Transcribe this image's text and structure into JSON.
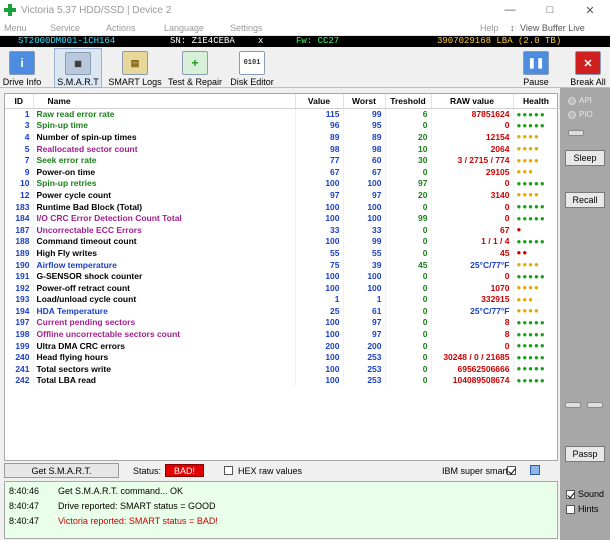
{
  "window": {
    "title": "Victoria 5.37 HDD/SSD | Device 2",
    "buttons": {
      "minimize": "—",
      "maximize": "□",
      "close": "✕"
    }
  },
  "menu": [
    "Menu",
    "Service",
    "Actions",
    "Language",
    "Settings",
    "Help"
  ],
  "menu_right": {
    "help_arrow": "↕",
    "view_buffer": "View Buffer Live"
  },
  "infobar": {
    "model": "ST2000DM001-1CH164",
    "sn": "SN: Z1E4CEBA",
    "close": "x",
    "fw": "Fw: CC27",
    "lba": "3907029168 LBA (2.0 TB)"
  },
  "toolbar": [
    {
      "label": "Drive Info",
      "icon": "info-icon"
    },
    {
      "label": "S.M.A.R.T",
      "icon": "smart-icon"
    },
    {
      "label": "SMART Logs",
      "icon": "logs-icon"
    },
    {
      "label": "Test & Repair",
      "icon": "repair-icon"
    },
    {
      "label": "Disk Editor",
      "icon": "editor-icon"
    }
  ],
  "toolbar_right": {
    "pause": "Pause",
    "break": "Break All"
  },
  "table": {
    "headers": [
      "ID",
      "Name",
      "Value",
      "Worst",
      "Treshold",
      "RAW value",
      "Health"
    ],
    "rows": [
      {
        "id": "1",
        "name": "Raw read error rate",
        "value": "115",
        "worst": "99",
        "tres": "6",
        "raw": "87851624",
        "health": "●●●●●",
        "nc": "#1a7f1a",
        "rc": "#cc0000",
        "hc": "#1a9f1a"
      },
      {
        "id": "3",
        "name": "Spin-up time",
        "value": "96",
        "worst": "95",
        "tres": "0",
        "raw": "0",
        "health": "●●●●●",
        "nc": "#1a7f1a",
        "rc": "#cc0000",
        "hc": "#1a9f1a"
      },
      {
        "id": "4",
        "name": "Number of spin-up times",
        "value": "89",
        "worst": "89",
        "tres": "20",
        "raw": "12154",
        "health": "●●●●",
        "nc": "#000000",
        "rc": "#cc0000",
        "hc": "#e8a800"
      },
      {
        "id": "5",
        "name": "Reallocated sector count",
        "value": "98",
        "worst": "98",
        "tres": "10",
        "raw": "2064",
        "health": "●●●●",
        "nc": "#a0208f",
        "rc": "#cc0000",
        "hc": "#e8a800"
      },
      {
        "id": "7",
        "name": "Seek error rate",
        "value": "77",
        "worst": "60",
        "tres": "30",
        "raw": "3 / 2715 / 774",
        "health": "●●●●",
        "nc": "#1a7f1a",
        "rc": "#cc0000",
        "hc": "#e8a800"
      },
      {
        "id": "9",
        "name": "Power-on time",
        "value": "67",
        "worst": "67",
        "tres": "0",
        "raw": "29105",
        "health": "●●●",
        "nc": "#000000",
        "rc": "#cc0000",
        "hc": "#e8a800"
      },
      {
        "id": "10",
        "name": "Spin-up retries",
        "value": "100",
        "worst": "100",
        "tres": "97",
        "raw": "0",
        "health": "●●●●●",
        "nc": "#1a7f1a",
        "rc": "#cc0000",
        "hc": "#1a9f1a"
      },
      {
        "id": "12",
        "name": "Power cycle count",
        "value": "97",
        "worst": "97",
        "tres": "20",
        "raw": "3140",
        "health": "●●●●",
        "nc": "#000000",
        "rc": "#cc0000",
        "hc": "#e8a800"
      },
      {
        "id": "183",
        "name": "Runtime Bad Block (Total)",
        "value": "100",
        "worst": "100",
        "tres": "0",
        "raw": "0",
        "health": "●●●●●",
        "nc": "#000000",
        "rc": "#cc0000",
        "hc": "#1a9f1a"
      },
      {
        "id": "184",
        "name": "I/O CRC Error Detection Count Total",
        "value": "100",
        "worst": "100",
        "tres": "99",
        "raw": "0",
        "health": "●●●●●",
        "nc": "#a0208f",
        "rc": "#cc0000",
        "hc": "#1a9f1a"
      },
      {
        "id": "187",
        "name": "Uncorrectable ECC Errors",
        "value": "33",
        "worst": "33",
        "tres": "0",
        "raw": "67",
        "health": "●",
        "nc": "#a0208f",
        "rc": "#cc0000",
        "hc": "#cc0000"
      },
      {
        "id": "188",
        "name": "Command timeout count",
        "value": "100",
        "worst": "99",
        "tres": "0",
        "raw": "1 / 1 / 4",
        "health": "●●●●●",
        "nc": "#000000",
        "rc": "#cc0000",
        "hc": "#1a9f1a"
      },
      {
        "id": "189",
        "name": "High Fly writes",
        "value": "55",
        "worst": "55",
        "tres": "0",
        "raw": "45",
        "health": "●●",
        "nc": "#000000",
        "rc": "#cc0000",
        "hc": "#cc0000"
      },
      {
        "id": "190",
        "name": "Airflow temperature",
        "value": "75",
        "worst": "39",
        "tres": "45",
        "raw": "25°C/77°F",
        "health": "●●●●",
        "nc": "#1a3fc8",
        "rc": "#1a3fc8",
        "hc": "#e8a800"
      },
      {
        "id": "191",
        "name": "G-SENSOR shock counter",
        "value": "100",
        "worst": "100",
        "tres": "0",
        "raw": "0",
        "health": "●●●●●",
        "nc": "#000000",
        "rc": "#cc0000",
        "hc": "#1a9f1a"
      },
      {
        "id": "192",
        "name": "Power-off retract count",
        "value": "100",
        "worst": "100",
        "tres": "0",
        "raw": "1070",
        "health": "●●●●",
        "nc": "#000000",
        "rc": "#cc0000",
        "hc": "#e8a800"
      },
      {
        "id": "193",
        "name": "Load/unload cycle count",
        "value": "1",
        "worst": "1",
        "tres": "0",
        "raw": "332915",
        "health": "●●●",
        "nc": "#000000",
        "rc": "#cc0000",
        "hc": "#e8a800"
      },
      {
        "id": "194",
        "name": "HDA Temperature",
        "value": "25",
        "worst": "61",
        "tres": "0",
        "raw": "25°C/77°F",
        "health": "●●●●",
        "nc": "#1a3fc8",
        "rc": "#1a3fc8",
        "hc": "#e8a800"
      },
      {
        "id": "197",
        "name": "Current pending sectors",
        "value": "100",
        "worst": "97",
        "tres": "0",
        "raw": "8",
        "health": "●●●●●",
        "nc": "#a0208f",
        "rc": "#cc0000",
        "hc": "#1a9f1a"
      },
      {
        "id": "198",
        "name": "Offline uncorrectable sectors count",
        "value": "100",
        "worst": "97",
        "tres": "0",
        "raw": "8",
        "health": "●●●●●",
        "nc": "#a0208f",
        "rc": "#cc0000",
        "hc": "#1a9f1a"
      },
      {
        "id": "199",
        "name": "Ultra DMA CRC errors",
        "value": "200",
        "worst": "200",
        "tres": "0",
        "raw": "0",
        "health": "●●●●●",
        "nc": "#000000",
        "rc": "#cc0000",
        "hc": "#1a9f1a"
      },
      {
        "id": "240",
        "name": "Head flying hours",
        "value": "100",
        "worst": "253",
        "tres": "0",
        "raw": "30248 / 0 / 21685",
        "health": "●●●●●",
        "nc": "#000000",
        "rc": "#cc0000",
        "hc": "#1a9f1a"
      },
      {
        "id": "241",
        "name": "Total sectors write",
        "value": "100",
        "worst": "253",
        "tres": "0",
        "raw": "69562506666",
        "health": "●●●●●",
        "nc": "#000000",
        "rc": "#cc0000",
        "hc": "#1a9f1a"
      },
      {
        "id": "242",
        "name": "Total LBA read",
        "value": "100",
        "worst": "253",
        "tres": "0",
        "raw": "104089508674",
        "health": "●●●●●",
        "nc": "#000000",
        "rc": "#cc0000",
        "hc": "#1a9f1a"
      }
    ]
  },
  "rightpanel": {
    "api": "API",
    "pio": "PIO",
    "sleep": "Sleep",
    "recall": "Recall",
    "passp": "Passp",
    "sound": "Sound",
    "hints": "Hints"
  },
  "statusbar": {
    "get_smart": "Get S.M.A.R.T.",
    "status_label": "Status:",
    "status_value": "BAD!",
    "hex_raw": "HEX raw values",
    "ibm": "IBM super smart:"
  },
  "log": [
    {
      "time": "8:40:46",
      "msg": "Get S.M.A.R.T. command... OK",
      "color": "#000000"
    },
    {
      "time": "8:40:47",
      "msg": "Drive reported: SMART status = GOOD",
      "color": "#000000"
    },
    {
      "time": "8:40:47",
      "msg": "Victoria reported: SMART status = BAD!",
      "color": "#cc0000"
    }
  ]
}
